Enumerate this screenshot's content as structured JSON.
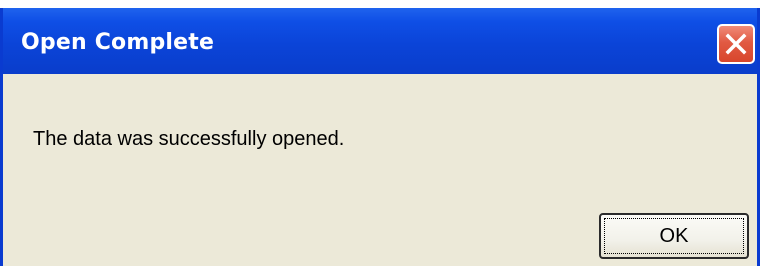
{
  "dialog": {
    "title": "Open Complete",
    "message": "The data was successfully opened.",
    "ok_label": "OK",
    "close_icon": "close-icon"
  },
  "colors": {
    "titlebar": "#0b44d8",
    "client_background": "#ece9d8",
    "close_button": "#d8462c"
  }
}
